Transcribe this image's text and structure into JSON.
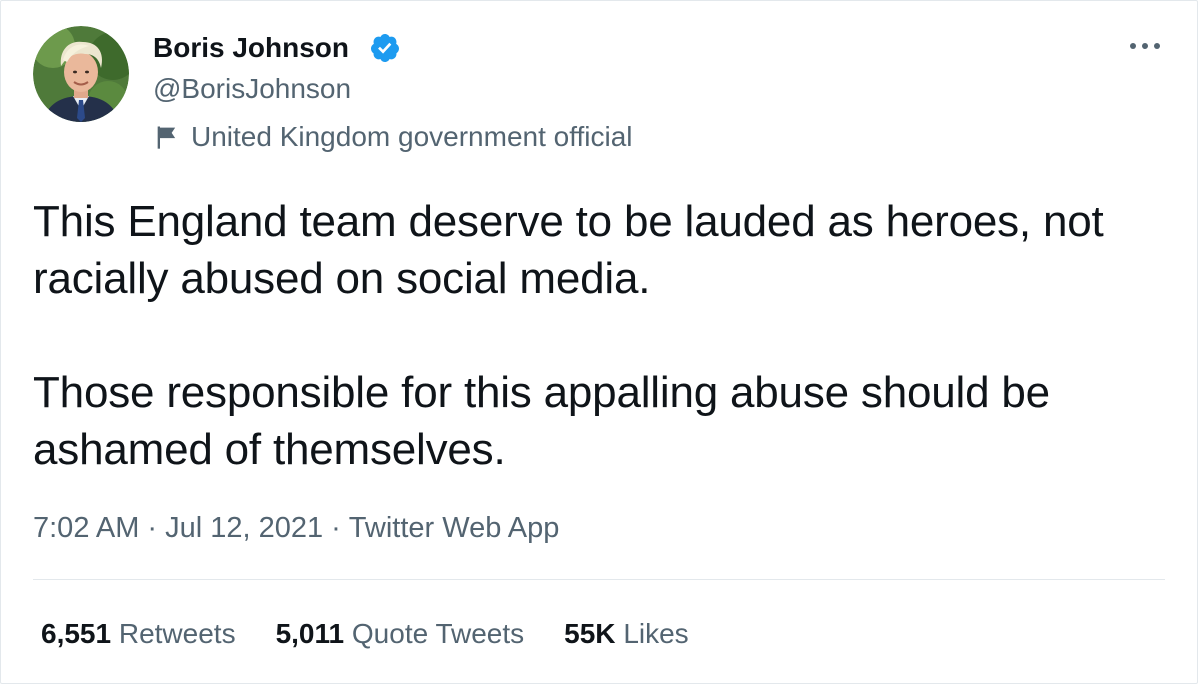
{
  "author": {
    "display_name": "Boris Johnson",
    "handle": "@BorisJohnson",
    "verified_icon": "verified-badge-icon",
    "label": "United Kingdom government official",
    "label_icon": "flag-icon"
  },
  "tweet": {
    "paragraphs": [
      "This England team deserve to be lauded as heroes, not racially abused on social media.",
      "Those responsible for this appalling abuse should be ashamed of themselves."
    ],
    "time": "7:02 AM",
    "date": "Jul 12, 2021",
    "source": "Twitter Web App",
    "separator": "·"
  },
  "stats": {
    "retweets": {
      "value": "6,551",
      "label": "Retweets"
    },
    "quote_tweets": {
      "value": "5,011",
      "label": "Quote Tweets"
    },
    "likes": {
      "value": "55K",
      "label": "Likes"
    }
  },
  "colors": {
    "text": "#0f1419",
    "secondary": "#536471",
    "verified": "#1d9bf0",
    "divider": "#e3e8ec"
  }
}
